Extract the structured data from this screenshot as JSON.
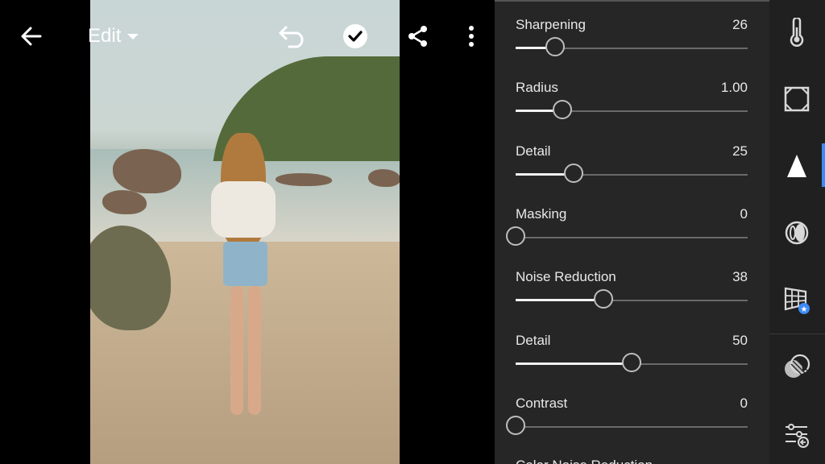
{
  "topbar": {
    "edit_label": "Edit"
  },
  "detail_panel": {
    "sliders": [
      {
        "label": "Sharpening",
        "value": "26",
        "fraction": 0.17
      },
      {
        "label": "Radius",
        "value": "1.00",
        "fraction": 0.2
      },
      {
        "label": "Detail",
        "value": "25",
        "fraction": 0.25
      },
      {
        "label": "Masking",
        "value": "0",
        "fraction": 0.0
      },
      {
        "label": "Noise Reduction",
        "value": "38",
        "fraction": 0.38
      },
      {
        "label": "Detail",
        "value": "50",
        "fraction": 0.5
      },
      {
        "label": "Contrast",
        "value": "0",
        "fraction": 0.0
      }
    ],
    "partial_label": "Color Noise Reduction"
  },
  "rail": {
    "icons": [
      "light-icon",
      "crop-icon",
      "detail-icon",
      "optics-icon",
      "geometry-icon",
      "effects-icon",
      "presets-icon"
    ],
    "active": "detail-icon",
    "accent": "#3d8af7"
  }
}
